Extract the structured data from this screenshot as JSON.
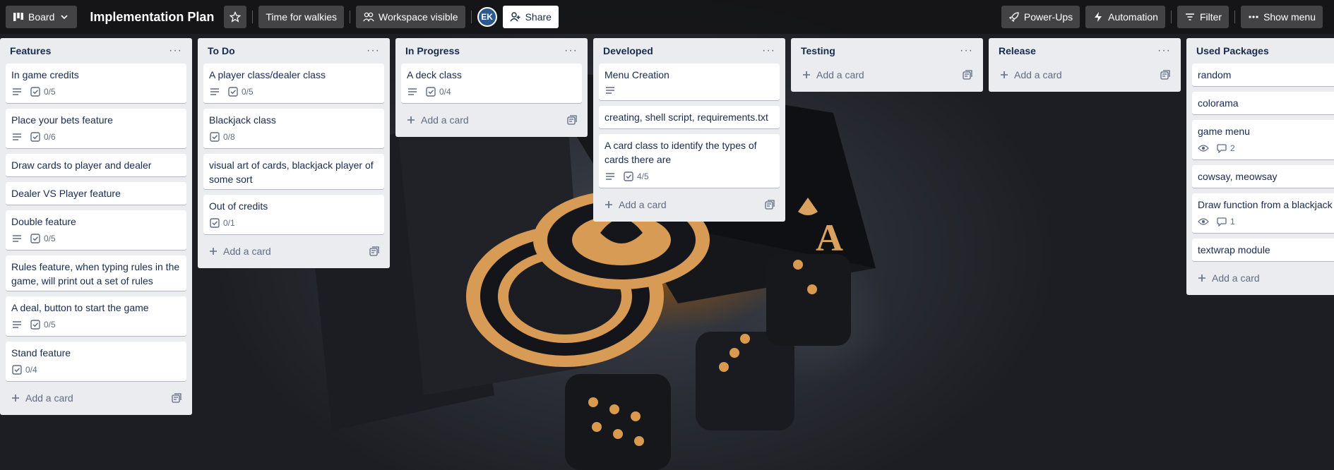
{
  "header": {
    "board_view": "Board",
    "title": "Implementation Plan",
    "time_label": "Time for walkies",
    "visibility_label": "Workspace visible",
    "avatar_initials": "EK",
    "share_label": "Share",
    "powerups_label": "Power-Ups",
    "automation_label": "Automation",
    "filter_label": "Filter",
    "menu_label": "Show menu"
  },
  "add_card_label": "Add a card",
  "lists": [
    {
      "title": "Features",
      "cards": [
        {
          "title": "In game credits",
          "desc": true,
          "checklist": "0/5"
        },
        {
          "title": "Place your bets feature",
          "desc": true,
          "checklist": "0/6"
        },
        {
          "title": "Draw cards to player and dealer"
        },
        {
          "title": "Dealer VS Player feature"
        },
        {
          "title": "Double feature",
          "desc": true,
          "checklist": "0/5"
        },
        {
          "title": "Rules feature, when typing rules in the game, will print out a set of rules"
        },
        {
          "title": "A deal, button to start the game",
          "desc": true,
          "checklist": "0/5"
        },
        {
          "title": "Stand feature",
          "checklist": "0/4"
        }
      ]
    },
    {
      "title": "To Do",
      "cards": [
        {
          "title": "A player class/dealer class",
          "desc": true,
          "checklist": "0/5"
        },
        {
          "title": "Blackjack class",
          "checklist": "0/8"
        },
        {
          "title": "visual art of cards, blackjack player of some sort"
        },
        {
          "title": "Out of credits",
          "checklist": "0/1"
        }
      ]
    },
    {
      "title": "In Progress",
      "cards": [
        {
          "title": "A deck class",
          "desc": true,
          "checklist": "0/4"
        }
      ]
    },
    {
      "title": "Developed",
      "cards": [
        {
          "title": "Menu Creation",
          "desc": true
        },
        {
          "title": "creating, shell script, requirements.txt"
        },
        {
          "title": "A card class to identify the types of cards there are",
          "desc": true,
          "checklist": "4/5"
        }
      ]
    },
    {
      "title": "Testing",
      "cards": []
    },
    {
      "title": "Release",
      "cards": []
    },
    {
      "title": "Used Packages",
      "cards": [
        {
          "title": "random"
        },
        {
          "title": "colorama"
        },
        {
          "title": "game menu",
          "watch": true,
          "comments": "2"
        },
        {
          "title": "cowsay, meowsay"
        },
        {
          "title": "Draw function from a blackjack",
          "watch": true,
          "comments": "1"
        },
        {
          "title": "textwrap module"
        }
      ]
    }
  ]
}
